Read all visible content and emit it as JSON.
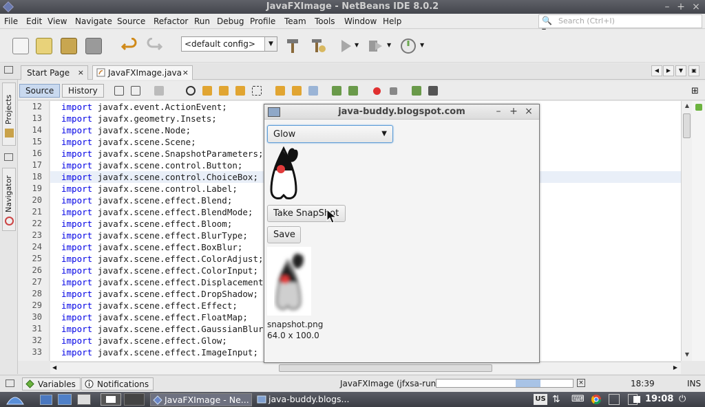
{
  "window": {
    "title": "JavaFXImage - NetBeans IDE 8.0.2",
    "controls": [
      "–",
      "+",
      "×"
    ]
  },
  "menu": [
    "File",
    "Edit",
    "View",
    "Navigate",
    "Source",
    "Refactor",
    "Run",
    "Debug",
    "Profile",
    "Team",
    "Tools",
    "Window",
    "Help"
  ],
  "search": {
    "placeholder": "Search (Ctrl+I)"
  },
  "toolbar": {
    "config": "<default config>"
  },
  "tabs": [
    {
      "label": "Start Page",
      "close": "×"
    },
    {
      "label": "JavaFXImage.java",
      "close": "×"
    }
  ],
  "editor_toolbar": {
    "source": "Source",
    "history": "History"
  },
  "side_tabs": [
    "Projects",
    "Navigator"
  ],
  "code": {
    "keyword": "import",
    "lines": [
      {
        "no": "12",
        "text": "javafx.event.ActionEvent;"
      },
      {
        "no": "13",
        "text": "javafx.geometry.Insets;"
      },
      {
        "no": "14",
        "text": "javafx.scene.Node;"
      },
      {
        "no": "15",
        "text": "javafx.scene.Scene;"
      },
      {
        "no": "16",
        "text": "javafx.scene.SnapshotParameters;"
      },
      {
        "no": "17",
        "text": "javafx.scene.control.Button;"
      },
      {
        "no": "18",
        "text": "javafx.scene.control.ChoiceBox;"
      },
      {
        "no": "19",
        "text": "javafx.scene.control.Label;"
      },
      {
        "no": "20",
        "text": "javafx.scene.effect.Blend;"
      },
      {
        "no": "21",
        "text": "javafx.scene.effect.BlendMode;"
      },
      {
        "no": "22",
        "text": "javafx.scene.effect.Bloom;"
      },
      {
        "no": "23",
        "text": "javafx.scene.effect.BlurType;"
      },
      {
        "no": "24",
        "text": "javafx.scene.effect.BoxBlur;"
      },
      {
        "no": "25",
        "text": "javafx.scene.effect.ColorAdjust;"
      },
      {
        "no": "26",
        "text": "javafx.scene.effect.ColorInput;"
      },
      {
        "no": "27",
        "text": "javafx.scene.effect.DisplacementMap;"
      },
      {
        "no": "28",
        "text": "javafx.scene.effect.DropShadow;"
      },
      {
        "no": "29",
        "text": "javafx.scene.effect.Effect;"
      },
      {
        "no": "30",
        "text": "javafx.scene.effect.FloatMap;"
      },
      {
        "no": "31",
        "text": "javafx.scene.effect.GaussianBlur;"
      },
      {
        "no": "32",
        "text": "javafx.scene.effect.Glow;"
      },
      {
        "no": "33",
        "text": "javafx.scene.effect.ImageInput;"
      }
    ]
  },
  "fx_window": {
    "title": "java-buddy.blogspot.com",
    "controls": [
      "–",
      "+",
      "×"
    ],
    "choice": "Glow",
    "take_snapshot": "Take SnapShot",
    "save": "Save",
    "file_name": "snapshot.png",
    "dimensions": "64.0 x 100.0"
  },
  "status": {
    "variables": "Variables",
    "notifications": "Notifications",
    "run_label": "JavaFXImage (jfxsa-run)",
    "stop": "×",
    "position": "18:39",
    "mode": "INS"
  },
  "taskbar": {
    "items": [
      "JavaFXImage - Ne...",
      "java-buddy.blogs..."
    ],
    "keyboard": "US",
    "time": "19:08"
  },
  "colors": {
    "keyword": "#0000e6",
    "title_bar": "#4e5058",
    "choice_focus": "#5a9bd6",
    "record": "#e03030"
  }
}
